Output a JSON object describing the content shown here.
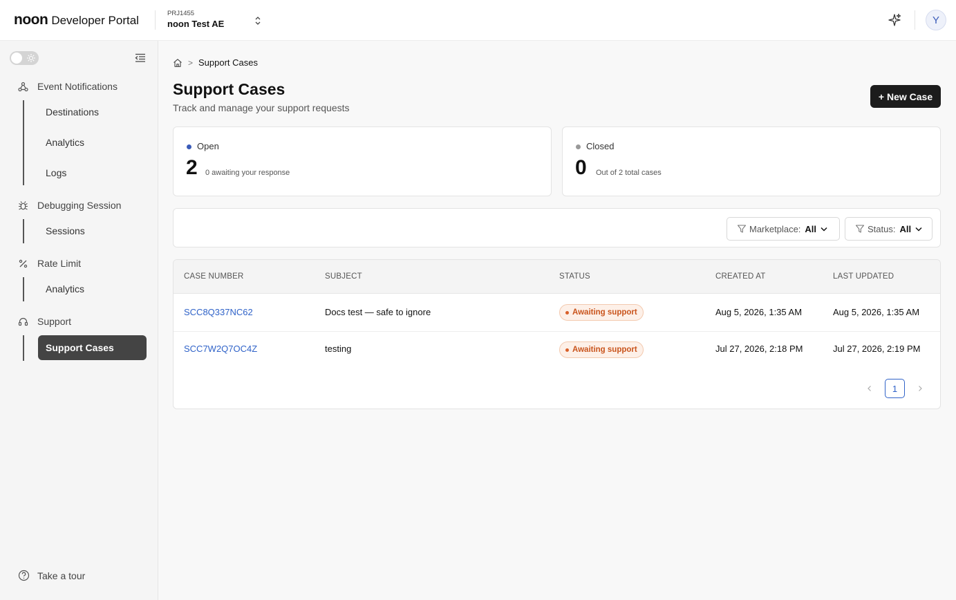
{
  "header": {
    "logo_brand": "noon",
    "logo_suffix": "Developer Portal",
    "project_id": "PRJ1455",
    "project_name": "noon Test AE",
    "avatar_initial": "Y"
  },
  "sidebar": {
    "sections": [
      {
        "label": "Event Notifications",
        "icon": "webhook-icon",
        "items": [
          "Destinations",
          "Analytics",
          "Logs"
        ]
      },
      {
        "label": "Debugging Session",
        "icon": "bug-icon",
        "items": [
          "Sessions"
        ]
      },
      {
        "label": "Rate Limit",
        "icon": "percent-icon",
        "items": [
          "Analytics"
        ]
      },
      {
        "label": "Support",
        "icon": "headset-icon",
        "items": [
          "Support Cases"
        ]
      }
    ],
    "active_item": "Support Cases",
    "tour_label": "Take a tour"
  },
  "breadcrumb": {
    "separator": ">",
    "current": "Support Cases"
  },
  "page": {
    "title": "Support Cases",
    "subtitle": "Track and manage your support requests",
    "new_case_label": "+ New Case"
  },
  "stats": {
    "open": {
      "label": "Open",
      "value": "2",
      "description": "0 awaiting your response",
      "color": "#3a5bb8"
    },
    "closed": {
      "label": "Closed",
      "value": "0",
      "description": "Out of 2 total cases",
      "color": "#999999"
    }
  },
  "filters": {
    "marketplace": {
      "label": "Marketplace:",
      "value": "All"
    },
    "status": {
      "label": "Status:",
      "value": "All"
    }
  },
  "table": {
    "columns": [
      "CASE NUMBER",
      "SUBJECT",
      "STATUS",
      "CREATED AT",
      "LAST UPDATED"
    ],
    "rows": [
      {
        "case_number": "SCC8Q337NC62",
        "subject": "Docs test — safe to ignore",
        "status": "Awaiting support",
        "created_at": "Aug 5, 2026, 1:35 AM",
        "last_updated": "Aug 5, 2026, 1:35 AM"
      },
      {
        "case_number": "SCC7W2Q7OC4Z",
        "subject": "testing",
        "status": "Awaiting support",
        "created_at": "Jul 27, 2026, 2:18 PM",
        "last_updated": "Jul 27, 2026, 2:19 PM"
      }
    ]
  },
  "pagination": {
    "current_page": "1"
  }
}
